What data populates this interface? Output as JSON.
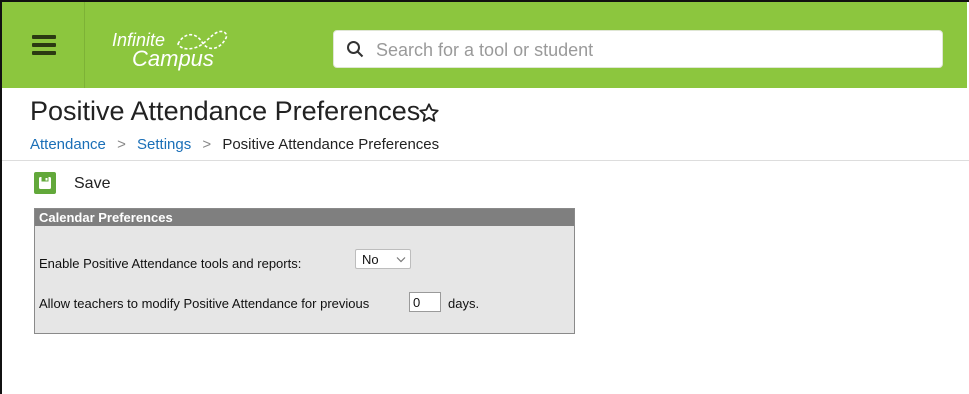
{
  "app": {
    "logo_line1": "Infinite",
    "logo_line2": "Campus"
  },
  "search": {
    "placeholder": "Search for a tool or student",
    "value": ""
  },
  "page": {
    "title": "Positive Attendance Preferences"
  },
  "breadcrumb": {
    "items": [
      "Attendance",
      "Settings",
      "Positive Attendance Preferences"
    ]
  },
  "toolbar": {
    "save_label": "Save"
  },
  "panel": {
    "title": "Calendar Preferences",
    "enable_label": "Enable Positive Attendance tools and reports:",
    "enable_value": "No",
    "modify_label": "Allow teachers to modify Positive Attendance for previous",
    "modify_value": "0",
    "modify_suffix": "days."
  },
  "colors": {
    "topbar": "#8cc63e",
    "link": "#1a6fb7",
    "save_icon": "#62a83a",
    "panel_header": "#7f7f7f",
    "panel_bg": "#e6e6e6"
  },
  "icons": {
    "menu": "hamburger-icon",
    "search": "search-icon",
    "favorite": "star-outline-icon",
    "save": "floppy-disk-icon",
    "dropdown": "chevron-down-icon"
  }
}
